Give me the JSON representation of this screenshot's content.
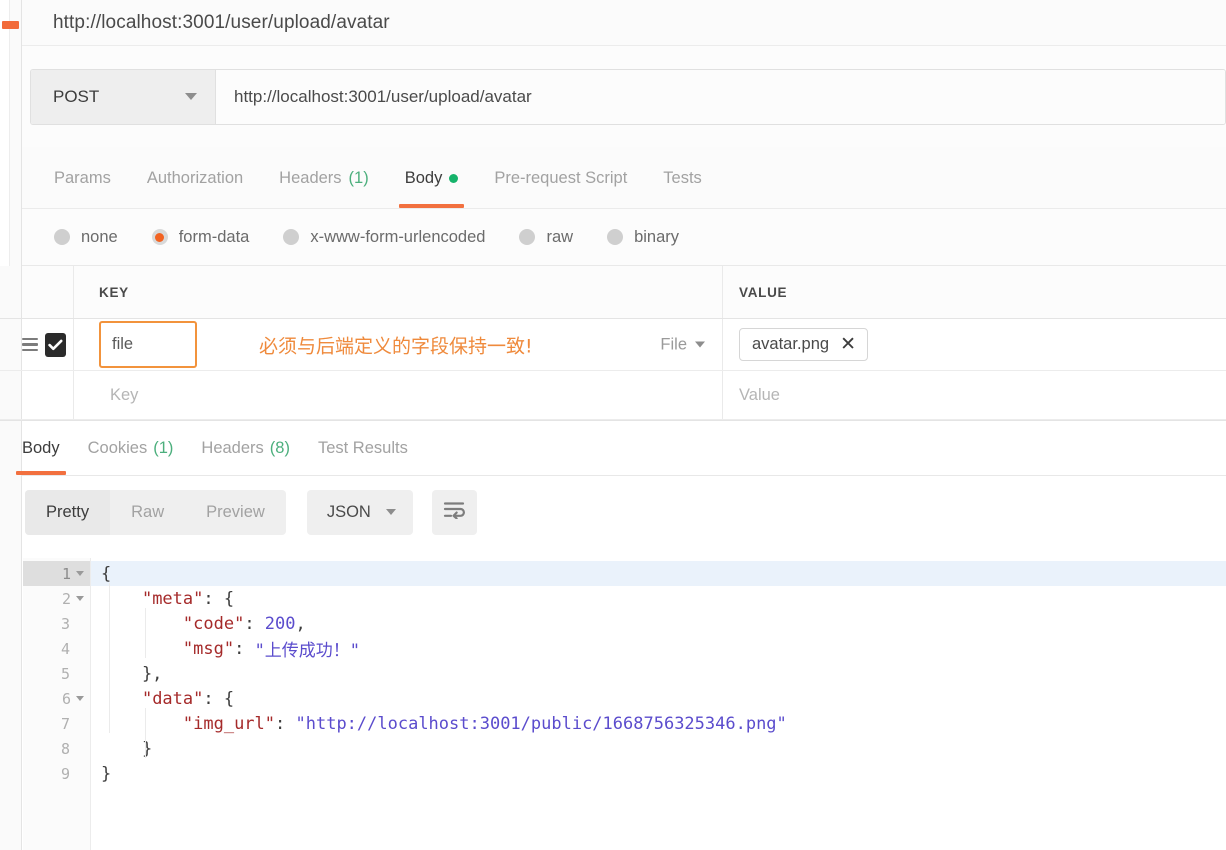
{
  "window": {
    "url_title": "http://localhost:3001/user/upload/avatar"
  },
  "request": {
    "method": "POST",
    "method_caret_icon": "chevron-down-icon",
    "url": "http://localhost:3001/user/upload/avatar",
    "tabs": [
      {
        "label": "Params",
        "count": "",
        "active": false,
        "dot": false
      },
      {
        "label": "Authorization",
        "count": "",
        "active": false,
        "dot": false
      },
      {
        "label": "Headers",
        "count": "(1)",
        "active": false,
        "dot": false
      },
      {
        "label": "Body",
        "count": "",
        "active": true,
        "dot": true
      },
      {
        "label": "Pre-request Script",
        "count": "",
        "active": false,
        "dot": false
      },
      {
        "label": "Tests",
        "count": "",
        "active": false,
        "dot": false
      }
    ],
    "body_types": [
      {
        "label": "none",
        "checked": false
      },
      {
        "label": "form-data",
        "checked": true
      },
      {
        "label": "x-www-form-urlencoded",
        "checked": false
      },
      {
        "label": "raw",
        "checked": false
      },
      {
        "label": "binary",
        "checked": false
      }
    ],
    "table": {
      "headers": {
        "key": "KEY",
        "value": "VALUE"
      },
      "row": {
        "checked": true,
        "key_value": "file",
        "annotation": "必须与后端定义的字段保持一致!",
        "type_label": "File",
        "file_chip": "avatar.png",
        "file_chip_remove": "✕"
      },
      "empty_row": {
        "key_placeholder": "Key",
        "value_placeholder": "Value"
      }
    }
  },
  "response": {
    "tabs": [
      {
        "label": "Body",
        "count": "",
        "active": true
      },
      {
        "label": "Cookies",
        "count": "(1)",
        "active": false
      },
      {
        "label": "Headers",
        "count": "(8)",
        "active": false
      },
      {
        "label": "Test Results",
        "count": "",
        "active": false
      }
    ],
    "view_modes": [
      {
        "label": "Pretty",
        "active": true
      },
      {
        "label": "Raw",
        "active": false
      },
      {
        "label": "Preview",
        "active": false
      }
    ],
    "format": "JSON",
    "format_caret_icon": "chevron-down-icon",
    "wrap_icon": "word-wrap-icon",
    "code_lines": [
      {
        "num": "1",
        "fold": true,
        "active": true,
        "tokens": [
          {
            "t": "{",
            "c": "punct"
          }
        ]
      },
      {
        "num": "2",
        "fold": true,
        "active": false,
        "tokens": [
          {
            "t": "    ",
            "c": "punct"
          },
          {
            "t": "\"meta\"",
            "c": "key"
          },
          {
            "t": ": {",
            "c": "punct"
          }
        ]
      },
      {
        "num": "3",
        "fold": false,
        "active": false,
        "tokens": [
          {
            "t": "        ",
            "c": "punct"
          },
          {
            "t": "\"code\"",
            "c": "key"
          },
          {
            "t": ": ",
            "c": "punct"
          },
          {
            "t": "200",
            "c": "num"
          },
          {
            "t": ",",
            "c": "punct"
          }
        ]
      },
      {
        "num": "4",
        "fold": false,
        "active": false,
        "tokens": [
          {
            "t": "        ",
            "c": "punct"
          },
          {
            "t": "\"msg\"",
            "c": "key"
          },
          {
            "t": ": ",
            "c": "punct"
          },
          {
            "t": "\"上传成功！\"",
            "c": "val"
          }
        ]
      },
      {
        "num": "5",
        "fold": false,
        "active": false,
        "tokens": [
          {
            "t": "    },",
            "c": "punct"
          }
        ]
      },
      {
        "num": "6",
        "fold": true,
        "active": false,
        "tokens": [
          {
            "t": "    ",
            "c": "punct"
          },
          {
            "t": "\"data\"",
            "c": "key"
          },
          {
            "t": ": {",
            "c": "punct"
          }
        ]
      },
      {
        "num": "7",
        "fold": false,
        "active": false,
        "tokens": [
          {
            "t": "        ",
            "c": "punct"
          },
          {
            "t": "\"img_url\"",
            "c": "key"
          },
          {
            "t": ": ",
            "c": "punct"
          },
          {
            "t": "\"http://localhost:3001/public/1668756325346.png\"",
            "c": "val"
          }
        ]
      },
      {
        "num": "8",
        "fold": false,
        "active": false,
        "tokens": [
          {
            "t": "    }",
            "c": "punct"
          }
        ]
      },
      {
        "num": "9",
        "fold": false,
        "active": false,
        "tokens": [
          {
            "t": "}",
            "c": "punct"
          }
        ]
      }
    ]
  },
  "colors": {
    "accent_orange": "#f2703f",
    "radio_orange": "#f26322",
    "annotation_orange": "#ef8a3c",
    "green_dot": "#16b36b",
    "count_green": "#4caf7d",
    "json_key": "#a52a2a",
    "json_value": "#5b4ccd",
    "active_line": "#eaf2fb"
  }
}
